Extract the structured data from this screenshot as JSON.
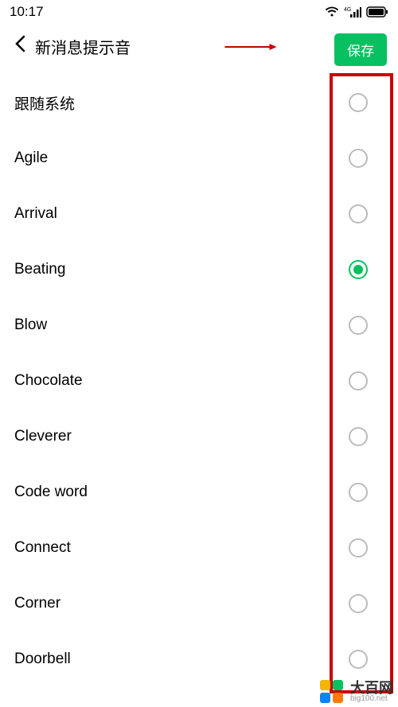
{
  "status": {
    "time": "10:17"
  },
  "header": {
    "title": "新消息提示音",
    "save_label": "保存"
  },
  "sounds": {
    "selected_index": 3,
    "items": [
      {
        "label": "跟随系统"
      },
      {
        "label": "Agile"
      },
      {
        "label": "Arrival"
      },
      {
        "label": "Beating"
      },
      {
        "label": "Blow"
      },
      {
        "label": "Chocolate"
      },
      {
        "label": "Cleverer"
      },
      {
        "label": "Code word"
      },
      {
        "label": "Connect"
      },
      {
        "label": "Corner"
      },
      {
        "label": "Doorbell"
      }
    ]
  },
  "watermark": {
    "main": "大百网",
    "sub": "big100.net"
  },
  "colors": {
    "accent": "#07c160",
    "annotation": "#c80000"
  }
}
